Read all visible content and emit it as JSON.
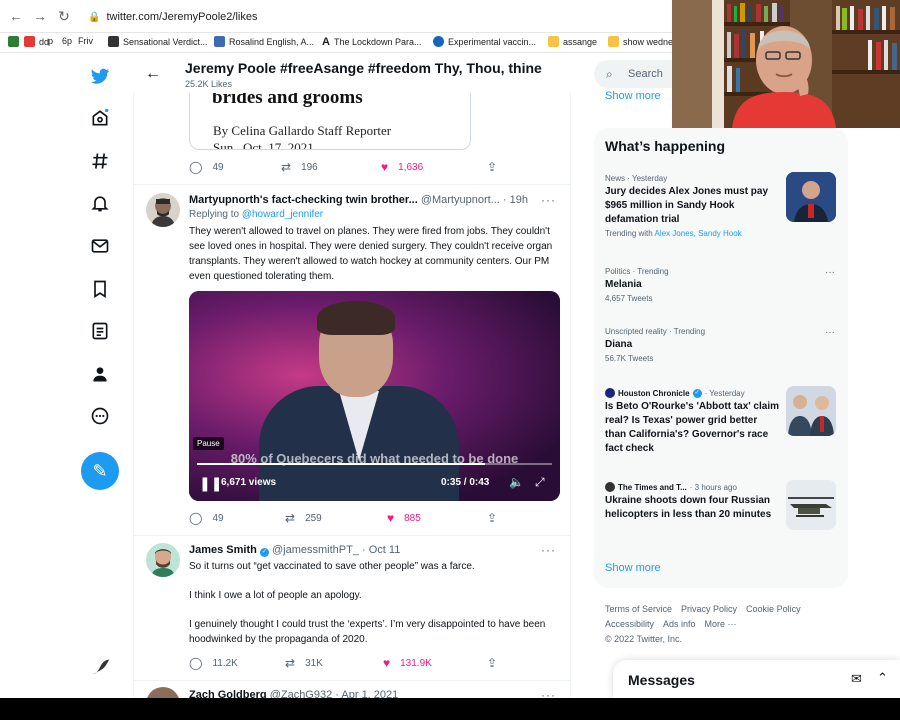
{
  "browser": {
    "url": "twitter.com/JeremyPoole2/likes",
    "bookmarks": [
      "dd",
      "p",
      "6p",
      "Friv",
      "Sensational Verdict...",
      "Rosalind English, A...",
      "The Lockdown Para...",
      "Experimental vaccin...",
      "assange",
      "show wedne"
    ]
  },
  "header": {
    "title": "Jeremy Poole #freeAsange #freedom Thy, Thou, thine",
    "subtitle": "25.2K Likes"
  },
  "card": {
    "heading": "brides and grooms",
    "byline": "By Celina Gallardo Staff Reporter",
    "date": "Sun., Oct. 17, 2021"
  },
  "tweet0_actions": {
    "replies": "49",
    "retweets": "196",
    "likes": "1,636"
  },
  "tweet1": {
    "name": "Martyupnorth's fact-checking twin brother...",
    "handle": "@Martyupnort...",
    "time": "· 19h",
    "replying_label": "Replying to ",
    "replying_to": "@howard_jennifer",
    "text": "They weren't allowed to travel on planes. They were fired from jobs. They couldn't see loved ones in hospital.  They were denied surgery. They couldn't receive organ transplants. They weren't allowed to watch hockey at community centers. Our PM even questioned tolerating them.",
    "video": {
      "caption": "80% of Quebecers did what needed to be done",
      "tooltip": "Pause",
      "views": "6,671 views",
      "time": "0:35 / 0:43",
      "progress": 0.81
    },
    "actions": {
      "replies": "49",
      "retweets": "259",
      "likes": "885"
    }
  },
  "tweet2": {
    "name": "James Smith",
    "handle": "@jamessmithPT_",
    "time": "· Oct 11",
    "line1": "So it turns out “get vaccinated to save other people” was a farce.",
    "line2": "I think I owe a lot of people an apology.",
    "line3": "I genuinely thought I could trust the ‘experts’. I’m very disappointed to have been hoodwinked by the propaganda of 2020.",
    "actions": {
      "replies": "11.2K",
      "retweets": "31K",
      "likes": "131.9K"
    }
  },
  "tweet3": {
    "name": "Zach Goldberg",
    "handle": "@ZachG932",
    "time": "· Apr 1, 2021"
  },
  "sidebar": {
    "search_placeholder": "Search",
    "show_more_top": "Show more",
    "trends_title": "What’s happening",
    "trends": [
      {
        "meta": "News · Yesterday",
        "topic": "Jury decides Alex Jones must pay $965 million in Sandy Hook defamation trial",
        "with_label": "Trending with ",
        "with": "Alex Jones, Sandy Hook"
      },
      {
        "meta": "Politics · Trending",
        "topic": "Melania",
        "count": "4,657 Tweets"
      },
      {
        "meta": "Unscripted reality · Trending",
        "topic": "Diana",
        "count": "56.7K Tweets"
      },
      {
        "source": "Houston Chronicle",
        "meta": "· Yesterday",
        "topic": "Is Beto O'Rourke's 'Abbott tax' claim real? Is Texas' power grid better than California's? Governor's race fact check"
      },
      {
        "source": "The Times and T...",
        "meta": "· 3 hours ago",
        "topic": "Ukraine shoots down four Russian helicopters in less than 20 minutes"
      }
    ],
    "show_more": "Show more",
    "footer": [
      "Terms of Service",
      "Privacy Policy",
      "Cookie Policy",
      "Accessibility",
      "Ads info",
      "More ···",
      "© 2022 Twitter, Inc."
    ],
    "messages": "Messages"
  },
  "colors": {
    "accent": "#1d9bf0",
    "like": "#f91880"
  }
}
